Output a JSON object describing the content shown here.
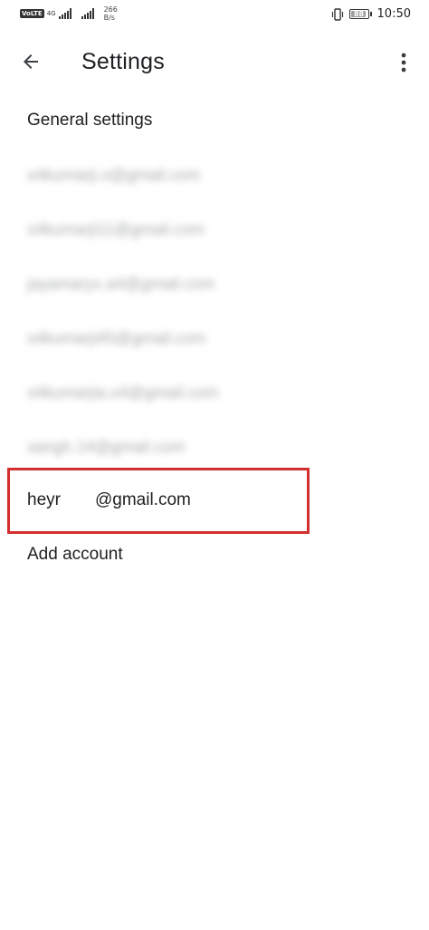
{
  "status_bar": {
    "volte": "VoLTE",
    "network_type": "4G",
    "net_speed_value": "266",
    "net_speed_unit": "B/s",
    "battery_level": "88",
    "battery_fraction": 0.88,
    "time": "10:50"
  },
  "app_bar": {
    "title": "Settings",
    "back_icon": "arrow-back-icon",
    "overflow_icon": "more-vert-icon"
  },
  "list": {
    "general_settings": "General settings",
    "blurred_accounts": [
      "s4kumarji.x@gmail.com",
      "s4kumarji11@gmail.com",
      "jayamaryx.a4@gmail.com",
      "s4kumarji45@gmail.com",
      "s4kumarjia.x4@gmail.com",
      "sangh.14@gmail.com"
    ],
    "highlighted_account_prefix": "heyr",
    "highlighted_account_suffix": "@gmail.com",
    "add_account": "Add account"
  },
  "colors": {
    "highlight_border": "#d32f2f",
    "text_primary": "#202124"
  }
}
